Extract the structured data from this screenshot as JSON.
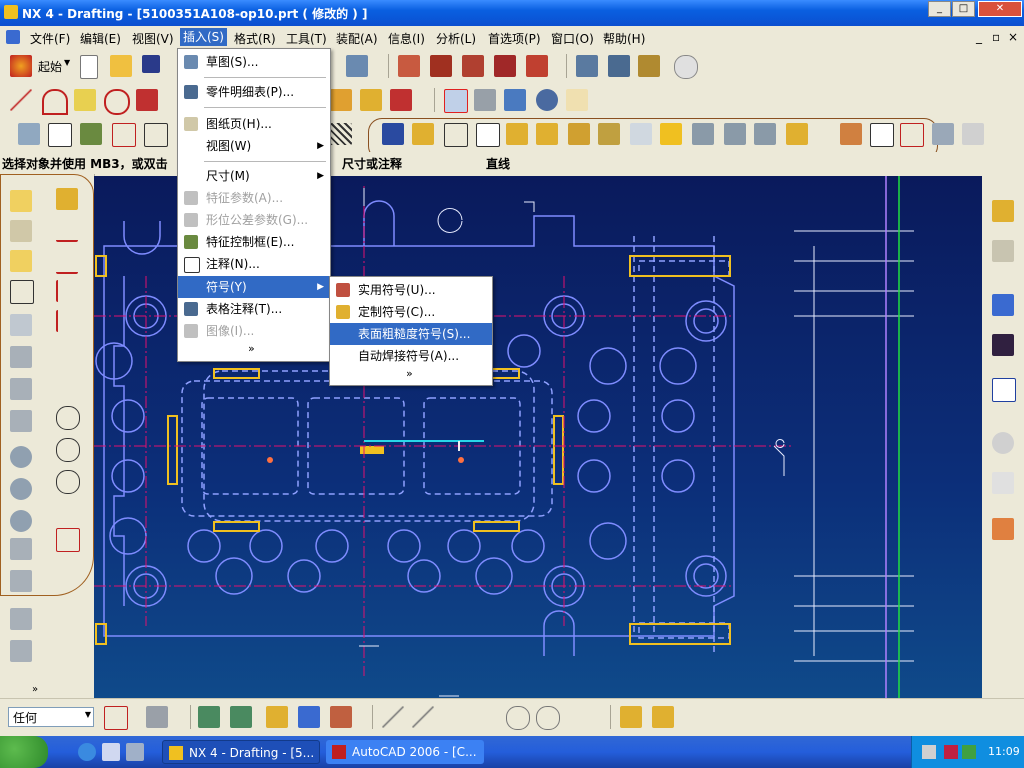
{
  "window": {
    "title": "NX 4 - Drafting - [5100351A108-op10.prt ( 修改的 ) ]",
    "min_label": "_",
    "max_label": "□",
    "close_label": "✕"
  },
  "menubar": {
    "items": [
      {
        "label": "文件(F)"
      },
      {
        "label": "编辑(E)"
      },
      {
        "label": "视图(V)"
      },
      {
        "label": "插入(S)"
      },
      {
        "label": "格式(R)"
      },
      {
        "label": "工具(T)"
      },
      {
        "label": "装配(A)"
      },
      {
        "label": "信息(I)"
      },
      {
        "label": "分析(L)"
      },
      {
        "label": "首选项(P)"
      },
      {
        "label": "窗口(O)"
      },
      {
        "label": "帮助(H)"
      }
    ],
    "right_controls": [
      "_",
      "▫",
      "×"
    ]
  },
  "toolbar1": {
    "start_label": "起始"
  },
  "status_row": {
    "prompt": "选择对象并使用 MB3，或双击",
    "middle_label": "尺寸或注释",
    "right_label": "直线"
  },
  "insert_menu": {
    "items": [
      {
        "label": "草图(S)...",
        "disabled": false,
        "submenu": false,
        "icon": "sketch-icon"
      },
      {
        "label": "零件明细表(P)...",
        "disabled": false,
        "submenu": false,
        "icon": "parts-list-icon"
      },
      {
        "label": "图纸页(H)...",
        "disabled": false,
        "submenu": false,
        "icon": "drawing-sheet-icon"
      },
      {
        "label": "视图(W)",
        "disabled": false,
        "submenu": true,
        "icon": ""
      },
      {
        "label": "尺寸(M)",
        "disabled": false,
        "submenu": true,
        "icon": ""
      },
      {
        "label": "特征参数(A)...",
        "disabled": true,
        "submenu": false,
        "icon": "feature-params-icon"
      },
      {
        "label": "形位公差参数(G)...",
        "disabled": true,
        "submenu": false,
        "icon": "gdt-params-icon"
      },
      {
        "label": "特征控制框(E)...",
        "disabled": false,
        "submenu": false,
        "icon": "feature-control-frame-icon"
      },
      {
        "label": "注释(N)...",
        "disabled": false,
        "submenu": false,
        "icon": "note-icon"
      },
      {
        "label": "符号(Y)",
        "disabled": false,
        "submenu": true,
        "icon": "",
        "highlighted": true
      },
      {
        "label": "表格注释(T)...",
        "disabled": false,
        "submenu": false,
        "icon": "tabular-note-icon"
      },
      {
        "label": "图像(I)...",
        "disabled": true,
        "submenu": false,
        "icon": "image-icon"
      }
    ],
    "more_label": "»"
  },
  "symbol_submenu": {
    "items": [
      {
        "label": "实用符号(U)...",
        "icon": "utility-symbol-icon"
      },
      {
        "label": "定制符号(C)...",
        "icon": "custom-symbol-icon"
      },
      {
        "label": "表面粗糙度符号(S)...",
        "icon": "",
        "highlighted": true
      },
      {
        "label": "自动焊接符号(A)...",
        "icon": ""
      }
    ],
    "more_label": "»"
  },
  "bottom_toolbar": {
    "filter_value": "任何"
  },
  "taskbar": {
    "tasks": [
      {
        "label": "NX 4 - Drafting - [5...",
        "active": true
      },
      {
        "label": "AutoCAD 2006 - [C...",
        "active": false
      }
    ],
    "clock": "11:09"
  },
  "colors": {
    "menu_highlight": "#316ac5",
    "canvas_top": "#0a1a5c",
    "canvas_bottom": "#0f4a8a",
    "hidden_line": "#8fa0ff",
    "center_line": "#e0106f",
    "highlight_yellow": "#f0c020"
  }
}
